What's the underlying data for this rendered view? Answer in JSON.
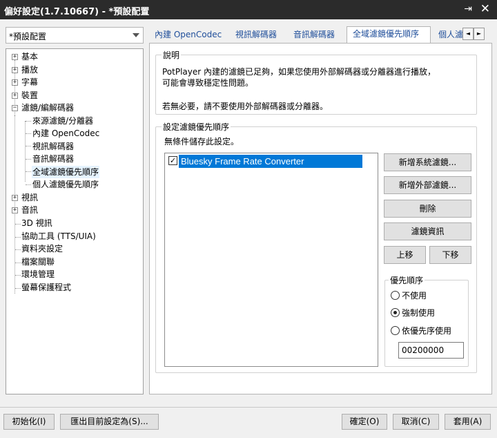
{
  "window": {
    "title": "偏好設定(1.7.10667) - *預設配置",
    "pin_icon": "pin-icon",
    "close_icon": "close-icon"
  },
  "profile": {
    "selected": "*預設配置"
  },
  "tree": {
    "items": [
      "基本",
      "播放",
      "字幕",
      "裝置",
      "濾鏡/編解碼器",
      "來源濾鏡/分離器",
      "內建 OpenCodec",
      "視訊解碼器",
      "音訊解碼器",
      "全域濾鏡優先順序",
      "個人濾鏡優先順序",
      "視訊",
      "音訊",
      "3D 視訊",
      "協助工具 (TTS/UIA)",
      "資料夾設定",
      "檔案關聯",
      "環境管理",
      "螢幕保護程式"
    ],
    "expand_symbols": {
      "plus": "+",
      "minus": "−"
    }
  },
  "tabs": {
    "items": [
      "內建 OpenCodec",
      "視訊解碼器",
      "音訊解碼器",
      "全域濾鏡優先順序",
      "個人濾"
    ],
    "scroll_left": "◄",
    "scroll_right": "►"
  },
  "description": {
    "label": "說明",
    "line1": "PotPlayer 內建的濾鏡已足夠，如果您使用外部解碼器或分離器進行播放，",
    "line2": "可能會導致穩定性問題。",
    "line3": "若無必要，請不要使用外部解碼器或分離器。"
  },
  "priority_settings": {
    "label": "設定濾鏡優先順序",
    "unconditional": "無條件儲存此設定。",
    "filters": [
      {
        "name": "Bluesky Frame Rate Converter",
        "checked": true,
        "check_mark": "✓"
      }
    ],
    "buttons": {
      "add_system": "新增系統濾鏡...",
      "add_external": "新增外部濾鏡...",
      "delete": "刪除",
      "filter_info": "濾鏡資訊",
      "move_up": "上移",
      "move_down": "下移"
    },
    "priority": {
      "label": "優先順序",
      "options": [
        "不使用",
        "強制使用",
        "依優先序使用"
      ],
      "selected_index": 1,
      "value": "00200000"
    }
  },
  "footer": {
    "reset": "初始化(I)",
    "export": "匯出目前設定為(S)...",
    "ok": "確定(O)",
    "cancel": "取消(C)",
    "apply": "套用(A)"
  }
}
